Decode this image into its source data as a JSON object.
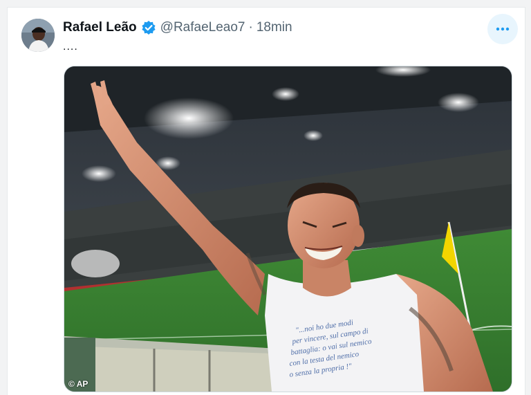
{
  "tweet": {
    "author_name": "Rafael Leão",
    "handle": "@RafaeLeao7",
    "separator": "·",
    "time": "18min",
    "text": "....",
    "verified_icon": "verified-badge-icon",
    "more_icon": "more-horizontal-icon",
    "media": {
      "credit": "© AP",
      "jersey_text": [
        "\"...noi ho due modi",
        "per vincere, sul campo di",
        "battaglia: o vai sul nemico",
        "con la testa del nemico",
        "o senza la propria !\""
      ]
    }
  },
  "colors": {
    "accent": "#1d9bf0",
    "pitch": "#3f8a35",
    "corner_flag": "#f2d500"
  }
}
